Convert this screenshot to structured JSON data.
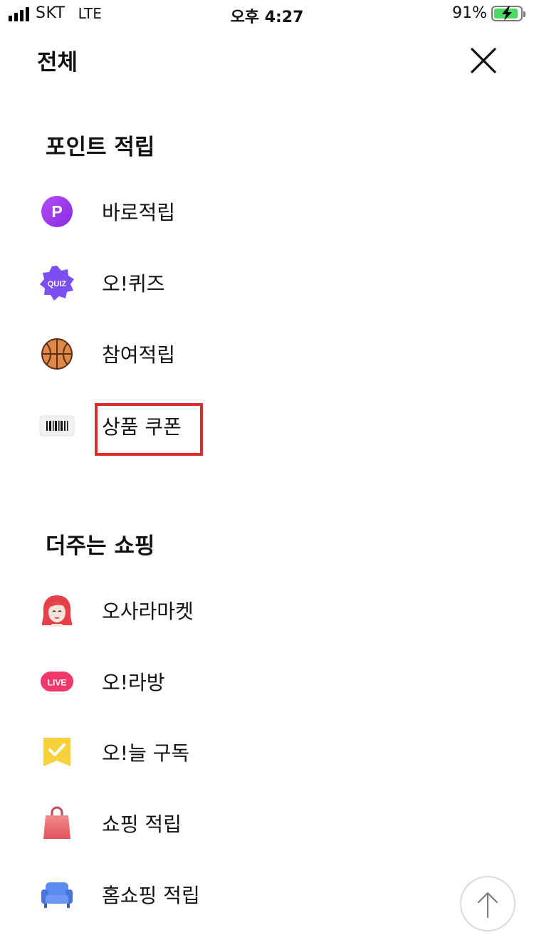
{
  "status_bar": {
    "carrier": "SKT",
    "network": "LTE",
    "time": "오후 4:27",
    "battery_percent": "91%",
    "battery_level": 0.91
  },
  "header": {
    "title": "전체",
    "close_icon": "close-icon"
  },
  "sections": [
    {
      "title": "포인트 적립",
      "items": [
        {
          "label": "바로적립",
          "icon": "p-point-icon",
          "icon_text": "P"
        },
        {
          "label": "오!퀴즈",
          "icon": "quiz-badge-icon",
          "icon_text": "QUIZ"
        },
        {
          "label": "참여적립",
          "icon": "basketball-icon"
        },
        {
          "label": "상품 쿠폰",
          "icon": "barcode-icon",
          "highlighted": true
        }
      ]
    },
    {
      "title": "더주는 쇼핑",
      "items": [
        {
          "label": "오사라마켓",
          "icon": "woman-face-icon"
        },
        {
          "label": "오!라방",
          "icon": "live-badge-icon",
          "icon_text": "LIVE"
        },
        {
          "label": "오!늘 구독",
          "icon": "check-bookmark-icon"
        },
        {
          "label": "쇼핑 적립",
          "icon": "shopping-bag-icon"
        },
        {
          "label": "홈쇼핑 적립",
          "icon": "sofa-icon"
        }
      ]
    }
  ],
  "scroll_top_button": {
    "icon": "arrow-up-icon"
  },
  "colors": {
    "highlight": "#e02b2b",
    "purple": "#9b3cf0",
    "live_pink": "#f0386b",
    "battery_green": "#4cd964"
  }
}
